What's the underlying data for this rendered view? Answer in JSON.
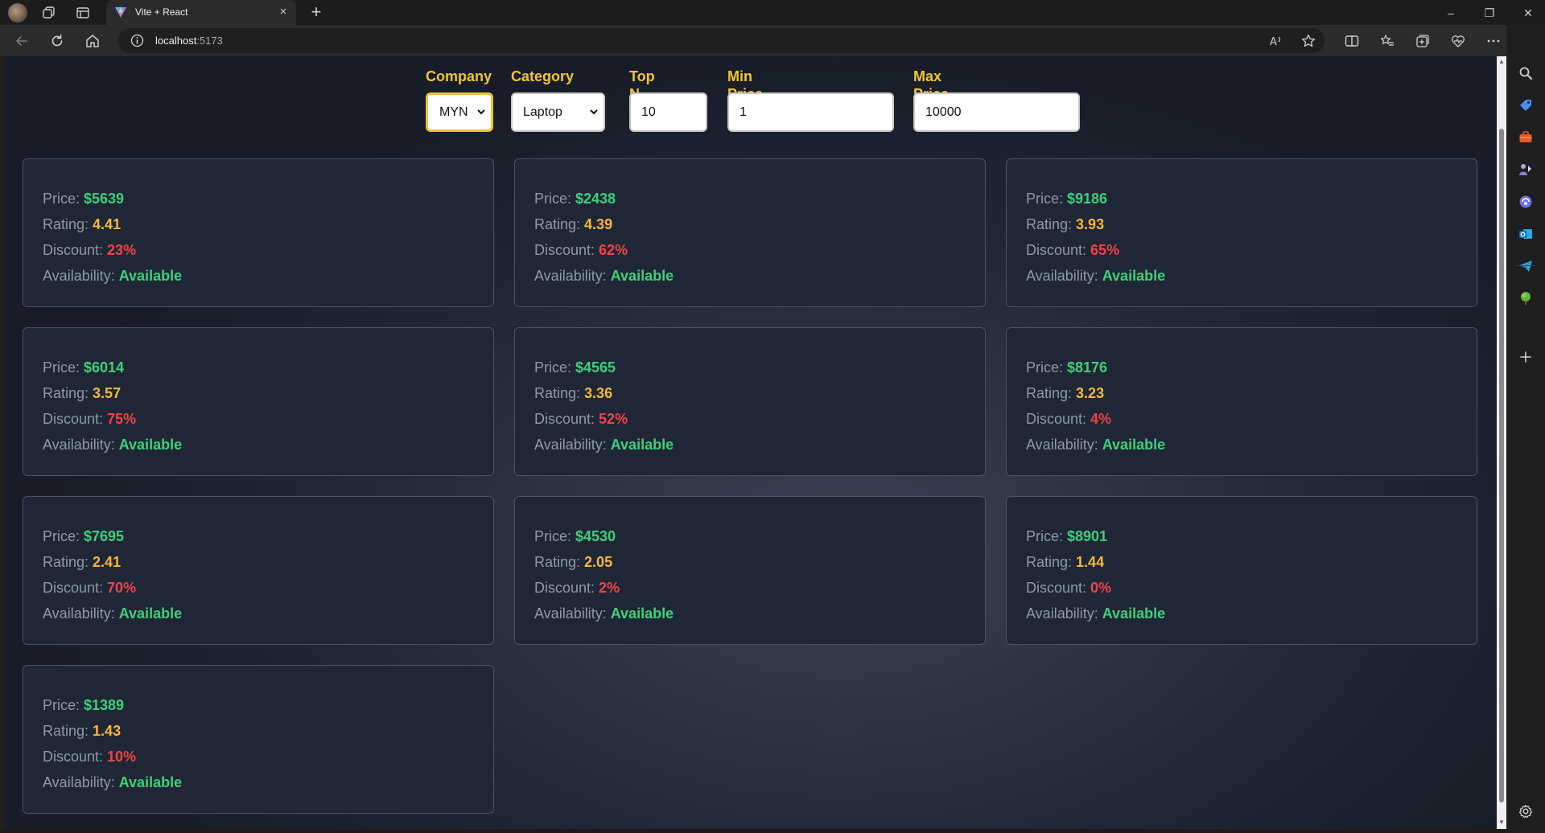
{
  "browser": {
    "tab_title": "Vite + React",
    "tab_close": "×",
    "new_tab": "+",
    "url_host": "localhost",
    "url_port": ":5173",
    "window_minimize": "–",
    "window_restore": "❐",
    "window_close": "✕"
  },
  "filters": {
    "company": {
      "label": "Company",
      "value": "MYN"
    },
    "category": {
      "label": "Category",
      "value": "Laptop"
    },
    "top_n": {
      "label": "Top N",
      "value": "10"
    },
    "min_price": {
      "label": "Min Price",
      "value": "1"
    },
    "max_price": {
      "label": "Max Price",
      "value": "10000"
    }
  },
  "field_labels": {
    "price": "Price: ",
    "rating": "Rating: ",
    "discount": "Discount: ",
    "availability": "Availability: "
  },
  "products": [
    {
      "price": "$5639",
      "rating": "4.41",
      "discount": "23%",
      "availability": "Available"
    },
    {
      "price": "$2438",
      "rating": "4.39",
      "discount": "62%",
      "availability": "Available"
    },
    {
      "price": "$9186",
      "rating": "3.93",
      "discount": "65%",
      "availability": "Available"
    },
    {
      "price": "$6014",
      "rating": "3.57",
      "discount": "75%",
      "availability": "Available"
    },
    {
      "price": "$4565",
      "rating": "3.36",
      "discount": "52%",
      "availability": "Available"
    },
    {
      "price": "$8176",
      "rating": "3.23",
      "discount": "4%",
      "availability": "Available"
    },
    {
      "price": "$7695",
      "rating": "2.41",
      "discount": "70%",
      "availability": "Available"
    },
    {
      "price": "$4530",
      "rating": "2.05",
      "discount": "2%",
      "availability": "Available"
    },
    {
      "price": "$8901",
      "rating": "1.44",
      "discount": "0%",
      "availability": "Available"
    },
    {
      "price": "$1389",
      "rating": "1.43",
      "discount": "10%",
      "availability": "Available"
    }
  ],
  "colors": {
    "accent_label": "#f4c531",
    "price": "#3fd07b",
    "rating": "#f6b83a",
    "discount": "#f2434a",
    "availability": "#3fd07b"
  }
}
